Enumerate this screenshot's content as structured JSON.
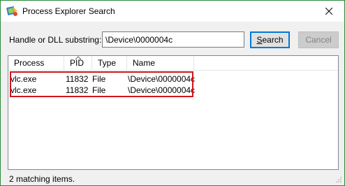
{
  "window": {
    "title": "Process Explorer Search"
  },
  "search": {
    "label": "Handle or DLL substring:",
    "value": "\\Device\\0000004c",
    "search_button_underlined": "S",
    "search_button_rest": "earch",
    "cancel_button": "Cancel"
  },
  "results": {
    "columns": [
      "Process",
      "PID",
      "Type",
      "Name"
    ],
    "sorted_column": "PID",
    "rows": [
      {
        "process": "vlc.exe",
        "pid": "11832",
        "type": "File",
        "name": "\\Device\\0000004c"
      },
      {
        "process": "vlc.exe",
        "pid": "11832",
        "type": "File",
        "name": "\\Device\\0000004c"
      }
    ]
  },
  "status": {
    "text": "2 matching items."
  },
  "colors": {
    "highlight_border": "#d0161e",
    "window_border": "#2d8a3a",
    "focus_button_border": "#0078d7"
  },
  "icons": {
    "app": "process-explorer-icon",
    "close": "close-icon",
    "sort": "sort-ascending-icon"
  }
}
